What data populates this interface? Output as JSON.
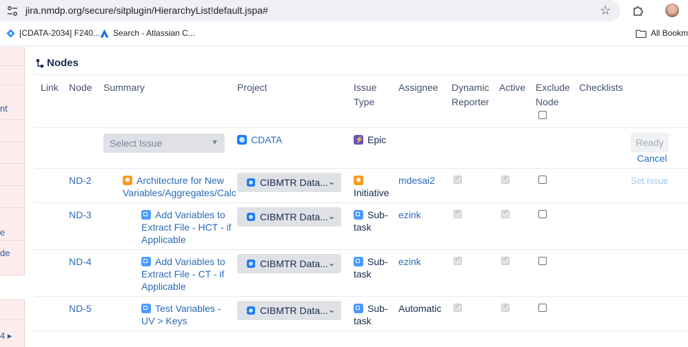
{
  "browser": {
    "url": "jira.nmdp.org/secure/sitplugin/HierarchyList!default.jspa#",
    "bookmarks": [
      {
        "label": "[CDATA-2034] F240..."
      },
      {
        "label": "Search - Atlassian C..."
      }
    ],
    "all_bookmarks_label": "All Bookmarks"
  },
  "sidebar": {
    "fragments": [
      "nt",
      "e",
      "de",
      "4"
    ]
  },
  "nodes_panel": {
    "title": "Nodes",
    "columns": {
      "link": "Link",
      "node": "Node",
      "summary": "Summary",
      "project": "Project",
      "issue_type_1": "Issue",
      "issue_type_2": "Type",
      "assignee": "Assignee",
      "dynamic_1": "Dynamic",
      "dynamic_2": "Reporter",
      "active": "Active",
      "exclude_1": "Exclude",
      "exclude_2": "Node",
      "checklists": "Checklists"
    },
    "new_row": {
      "select_placeholder": "Select Issue",
      "project": "CDATA",
      "issue_type": "Epic",
      "ready_label": "Ready",
      "cancel_label": "Cancel"
    },
    "rows": [
      {
        "node": "ND-2",
        "summary_1": "Architecture for New",
        "summary_2": "Variables/Aggregates/Calc",
        "project": "CIBMTR Data...",
        "issue_type_1": "",
        "issue_type_2": "Initiative",
        "assignee": "mdesai2",
        "dynamic_reporter": true,
        "active": true,
        "exclude_node": false,
        "action": "Set Issue"
      },
      {
        "node": "ND-3",
        "summary_1": "Add Variables to",
        "summary_2": "Extract File - HCT - if",
        "summary_3": "Applicable",
        "project": "CIBMTR Data...",
        "issue_type_1": "Sub-",
        "issue_type_2": "task",
        "assignee": "ezink",
        "dynamic_reporter": true,
        "active": true,
        "exclude_node": false
      },
      {
        "node": "ND-4",
        "summary_1": "Add Variables to",
        "summary_2": "Extract File - CT - if",
        "summary_3": "Applicable",
        "project": "CIBMTR Data...",
        "issue_type_1": "Sub-",
        "issue_type_2": "task",
        "assignee": "ezink",
        "dynamic_reporter": true,
        "active": true,
        "exclude_node": false
      },
      {
        "node": "ND-5",
        "summary_1": "Test Variables -",
        "summary_2": "UV > Keys",
        "project": "CIBMTR Data...",
        "issue_type_1": "Sub-",
        "issue_type_2": "task",
        "assignee": "Automatic",
        "dynamic_reporter": true,
        "active": true,
        "exclude_node": false
      }
    ]
  },
  "colors": {
    "link": "#2b6bb5",
    "sidebar_bg": "#fdecec",
    "select_bg": "#dfe1e6"
  }
}
